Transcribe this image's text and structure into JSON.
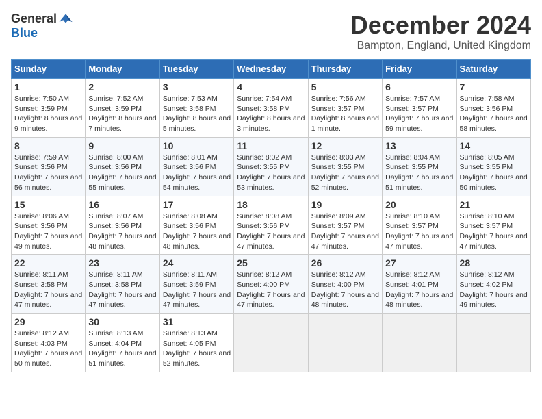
{
  "header": {
    "logo_general": "General",
    "logo_blue": "Blue",
    "month_title": "December 2024",
    "subtitle": "Bampton, England, United Kingdom"
  },
  "weekdays": [
    "Sunday",
    "Monday",
    "Tuesday",
    "Wednesday",
    "Thursday",
    "Friday",
    "Saturday"
  ],
  "weeks": [
    [
      {
        "day": "1",
        "content": "Sunrise: 7:50 AM\nSunset: 3:59 PM\nDaylight: 8 hours\nand 9 minutes."
      },
      {
        "day": "2",
        "content": "Sunrise: 7:52 AM\nSunset: 3:59 PM\nDaylight: 8 hours\nand 7 minutes."
      },
      {
        "day": "3",
        "content": "Sunrise: 7:53 AM\nSunset: 3:58 PM\nDaylight: 8 hours\nand 5 minutes."
      },
      {
        "day": "4",
        "content": "Sunrise: 7:54 AM\nSunset: 3:58 PM\nDaylight: 8 hours\nand 3 minutes."
      },
      {
        "day": "5",
        "content": "Sunrise: 7:56 AM\nSunset: 3:57 PM\nDaylight: 8 hours\nand 1 minute."
      },
      {
        "day": "6",
        "content": "Sunrise: 7:57 AM\nSunset: 3:57 PM\nDaylight: 7 hours\nand 59 minutes."
      },
      {
        "day": "7",
        "content": "Sunrise: 7:58 AM\nSunset: 3:56 PM\nDaylight: 7 hours\nand 58 minutes."
      }
    ],
    [
      {
        "day": "8",
        "content": "Sunrise: 7:59 AM\nSunset: 3:56 PM\nDaylight: 7 hours\nand 56 minutes."
      },
      {
        "day": "9",
        "content": "Sunrise: 8:00 AM\nSunset: 3:56 PM\nDaylight: 7 hours\nand 55 minutes."
      },
      {
        "day": "10",
        "content": "Sunrise: 8:01 AM\nSunset: 3:56 PM\nDaylight: 7 hours\nand 54 minutes."
      },
      {
        "day": "11",
        "content": "Sunrise: 8:02 AM\nSunset: 3:55 PM\nDaylight: 7 hours\nand 53 minutes."
      },
      {
        "day": "12",
        "content": "Sunrise: 8:03 AM\nSunset: 3:55 PM\nDaylight: 7 hours\nand 52 minutes."
      },
      {
        "day": "13",
        "content": "Sunrise: 8:04 AM\nSunset: 3:55 PM\nDaylight: 7 hours\nand 51 minutes."
      },
      {
        "day": "14",
        "content": "Sunrise: 8:05 AM\nSunset: 3:55 PM\nDaylight: 7 hours\nand 50 minutes."
      }
    ],
    [
      {
        "day": "15",
        "content": "Sunrise: 8:06 AM\nSunset: 3:56 PM\nDaylight: 7 hours\nand 49 minutes."
      },
      {
        "day": "16",
        "content": "Sunrise: 8:07 AM\nSunset: 3:56 PM\nDaylight: 7 hours\nand 48 minutes."
      },
      {
        "day": "17",
        "content": "Sunrise: 8:08 AM\nSunset: 3:56 PM\nDaylight: 7 hours\nand 48 minutes."
      },
      {
        "day": "18",
        "content": "Sunrise: 8:08 AM\nSunset: 3:56 PM\nDaylight: 7 hours\nand 47 minutes."
      },
      {
        "day": "19",
        "content": "Sunrise: 8:09 AM\nSunset: 3:57 PM\nDaylight: 7 hours\nand 47 minutes."
      },
      {
        "day": "20",
        "content": "Sunrise: 8:10 AM\nSunset: 3:57 PM\nDaylight: 7 hours\nand 47 minutes."
      },
      {
        "day": "21",
        "content": "Sunrise: 8:10 AM\nSunset: 3:57 PM\nDaylight: 7 hours\nand 47 minutes."
      }
    ],
    [
      {
        "day": "22",
        "content": "Sunrise: 8:11 AM\nSunset: 3:58 PM\nDaylight: 7 hours\nand 47 minutes."
      },
      {
        "day": "23",
        "content": "Sunrise: 8:11 AM\nSunset: 3:58 PM\nDaylight: 7 hours\nand 47 minutes."
      },
      {
        "day": "24",
        "content": "Sunrise: 8:11 AM\nSunset: 3:59 PM\nDaylight: 7 hours\nand 47 minutes."
      },
      {
        "day": "25",
        "content": "Sunrise: 8:12 AM\nSunset: 4:00 PM\nDaylight: 7 hours\nand 47 minutes."
      },
      {
        "day": "26",
        "content": "Sunrise: 8:12 AM\nSunset: 4:00 PM\nDaylight: 7 hours\nand 48 minutes."
      },
      {
        "day": "27",
        "content": "Sunrise: 8:12 AM\nSunset: 4:01 PM\nDaylight: 7 hours\nand 48 minutes."
      },
      {
        "day": "28",
        "content": "Sunrise: 8:12 AM\nSunset: 4:02 PM\nDaylight: 7 hours\nand 49 minutes."
      }
    ],
    [
      {
        "day": "29",
        "content": "Sunrise: 8:12 AM\nSunset: 4:03 PM\nDaylight: 7 hours\nand 50 minutes."
      },
      {
        "day": "30",
        "content": "Sunrise: 8:13 AM\nSunset: 4:04 PM\nDaylight: 7 hours\nand 51 minutes."
      },
      {
        "day": "31",
        "content": "Sunrise: 8:13 AM\nSunset: 4:05 PM\nDaylight: 7 hours\nand 52 minutes."
      },
      null,
      null,
      null,
      null
    ]
  ]
}
